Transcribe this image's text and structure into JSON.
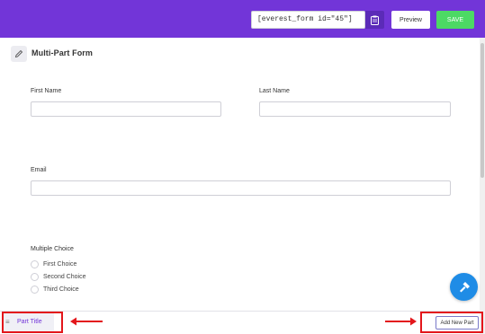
{
  "header": {
    "shortcode": "[everest_form id=\"45\"]",
    "preview_label": "Preview",
    "save_label": "SAVE"
  },
  "form": {
    "title": "Multi-Part Form",
    "fields": {
      "first_name_label": "First Name",
      "last_name_label": "Last Name",
      "email_label": "Email",
      "multiple_choice_label": "Multiple Choice",
      "choices": [
        "First Choice",
        "Second Choice",
        "Third Choice"
      ]
    }
  },
  "footer": {
    "part_title": "Part Title",
    "add_part_label": "Add New Part"
  },
  "colors": {
    "brand_purple": "#7235d8",
    "save_green": "#4cd964",
    "fab_blue": "#1f8ce6",
    "highlight_red": "#e3161b"
  }
}
